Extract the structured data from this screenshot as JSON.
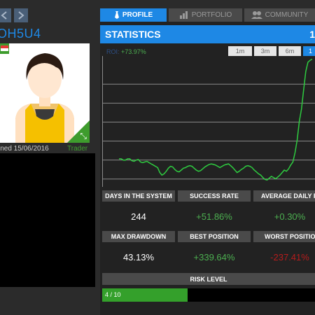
{
  "profile": {
    "username": "OH5U4",
    "joined": "ined 15/06/2016",
    "rank": "Trader"
  },
  "tabs": [
    {
      "label": "PROFILE",
      "icon": "tie-icon"
    },
    {
      "label": "PORTFOLIO",
      "icon": "bar-chart-icon"
    },
    {
      "label": "COMMUNITY",
      "icon": "people-icon"
    }
  ],
  "statistics": {
    "title": "STATISTICS",
    "title_edge": "1",
    "performance_label": "ROI:",
    "performance_value": "+73.97%",
    "periods": [
      "1m",
      "3m",
      "6m",
      "1"
    ]
  },
  "stats": {
    "days_label": "DAYS IN THE SYSTEM",
    "days_value": "244",
    "success_label": "SUCCESS RATE",
    "success_value": "+51.86%",
    "avg_label": "AVERAGE DAILY PA",
    "avg_value": "+0.30%",
    "drawdown_label": "MAX DRAWDOWN",
    "drawdown_value": "43.13%",
    "best_label": "BEST POSITION",
    "best_value": "+339.64%",
    "worst_label": "WORST POSITION",
    "worst_value": "-237.41%"
  },
  "risk": {
    "label": "RISK LEVEL",
    "value_text": "4 / 10",
    "fraction": 0.4
  },
  "colors": {
    "accent": "#1e88e5",
    "positive": "#4caf50",
    "negative": "#b71c1c",
    "line": "#2ecc40"
  },
  "chart_data": {
    "type": "line",
    "series": [
      {
        "values": [
          0,
          0,
          -2,
          -2,
          0,
          0,
          -3,
          -4,
          -2,
          -1,
          -5,
          -6,
          -5,
          -4,
          -6,
          -8,
          -10,
          -12,
          -14,
          -22,
          -26,
          -24,
          -20,
          -15,
          -12,
          -13,
          -17,
          -20,
          -21,
          -18,
          -15,
          -14,
          -12,
          -11,
          -12,
          -15,
          -18,
          -20,
          -19,
          -16,
          -13,
          -11,
          -9,
          -8,
          -9,
          -10,
          -12,
          -14,
          -12,
          -10,
          -9,
          -8,
          -11,
          -14,
          -18,
          -22,
          -20,
          -17,
          -15,
          -12,
          -11,
          -12,
          -14,
          -18,
          -21,
          -24,
          -26,
          -30,
          -33,
          -34,
          -31,
          -28,
          -30,
          -32,
          -29,
          -26,
          -22,
          -18,
          -20,
          -16,
          -10,
          -5,
          10,
          30,
          60,
          80,
          110,
          140,
          155,
          158,
          160
        ]
      }
    ]
  }
}
